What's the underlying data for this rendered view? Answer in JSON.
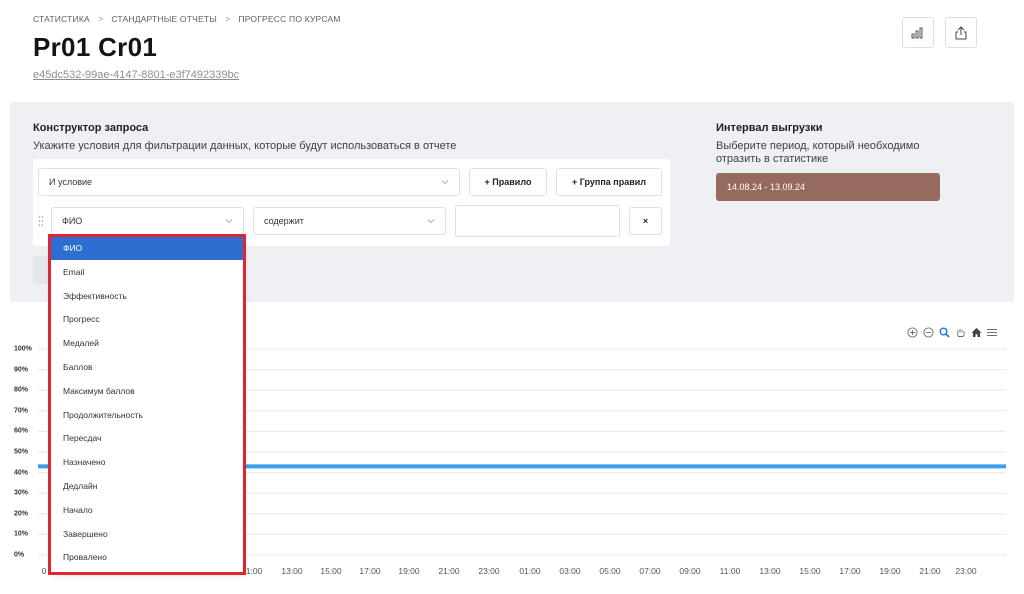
{
  "breadcrumb": [
    "СТАТИСТИКА",
    "СТАНДАРТНЫЕ ОТЧЕТЫ",
    "ПРОГРЕСС ПО КУРСАМ"
  ],
  "page": {
    "title": "Pr01 Cr01",
    "id": "e45dc532-99ae-4147-8801-e3f7492339bc"
  },
  "toolbar": {
    "chart_icon": "bar-chart-icon",
    "export_icon": "share-icon"
  },
  "query_builder": {
    "title": "Конструктор запроса",
    "subtitle": "Укажите условия для фильтрации данных, которые будут использоваться в отчете",
    "condition_value": "И условие",
    "add_rule_label": "+ Правило",
    "add_group_label": "+ Группа правил",
    "rule": {
      "field_value": "ФИО",
      "operator_value": "содержит",
      "value": "",
      "remove_label": "×"
    }
  },
  "interval": {
    "title": "Интервал выгрузки",
    "subtitle_line1": "Выберите период, который необходимо",
    "subtitle_line2": "отразить в статистике",
    "value": "14.08.24 - 13.09.24"
  },
  "field_dropdown": {
    "selected": "ФИО",
    "options": [
      "ФИО",
      "Email",
      "Эффективность",
      "Прогресс",
      "Медалей",
      "Баллов",
      "Максимум баллов",
      "Продолжительность",
      "Пересдач",
      "Назначено",
      "Дедлайн",
      "Начало",
      "Завершено",
      "Провалено"
    ]
  },
  "chart_tools": [
    "zoom-in-icon",
    "zoom-out-icon",
    "magnify-icon",
    "pan-hand-icon",
    "home-icon",
    "menu-icon"
  ],
  "chart_data": {
    "type": "line",
    "y_ticks": [
      "100%",
      "90%",
      "80%",
      "70%",
      "60%",
      "50%",
      "40%",
      "30%",
      "20%",
      "10%",
      "0%"
    ],
    "x_ticks_visible": [
      "0",
      "1:00",
      "13:00",
      "15:00",
      "17:00",
      "19:00",
      "21:00",
      "23:00",
      "01:00",
      "03:00",
      "05:00",
      "07:00",
      "09:00",
      "11:00",
      "13:00",
      "15:00",
      "17:00",
      "19:00",
      "21:00",
      "23:00"
    ],
    "ylim": [
      0,
      100
    ],
    "grid": true,
    "series": [
      {
        "values": [
          43,
          43
        ],
        "color": "#3a9fe6"
      }
    ]
  }
}
